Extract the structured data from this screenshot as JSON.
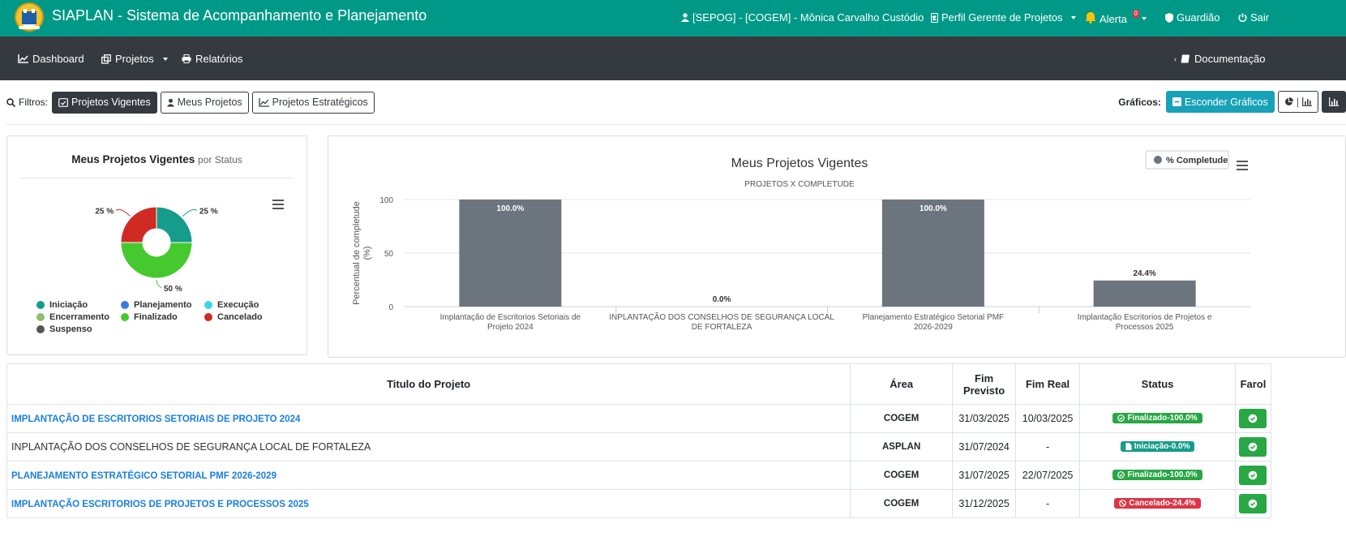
{
  "header": {
    "app_title": "SIAPLAN - Sistema de Acompanhamento e Planejamento",
    "user": "[SEPOG] - [COGEM] - Mônica Carvalho Custódio",
    "profile": "Perfil Gerente de Projetos",
    "alert_label": "Alerta",
    "alert_count": "0",
    "guardian": "Guardião",
    "logout": "Sair"
  },
  "navbar": {
    "dashboard": "Dashboard",
    "projects": "Projetos",
    "reports": "Relatórios",
    "documentation": "Documentação"
  },
  "filters": {
    "label": "Filtros:",
    "current": "Projetos Vigentes",
    "mine": "Meus Projetos",
    "strategic": "Projetos Estratégicos"
  },
  "charts_ctrl": {
    "label": "Gráficos:",
    "hide": "Esconder Gráficos"
  },
  "pie_card": {
    "title": "Meus Projetos Vigentes",
    "subtitle": "por Status"
  },
  "bar_card": {
    "title": "Meus Projetos Vigentes",
    "subtitle": "PROJETOS X COMPLETUDE",
    "legend": "% Completude",
    "ylabel": "Percentual de completude (%)"
  },
  "chart_data": [
    {
      "type": "pie",
      "title": "Meus Projetos Vigentes por Status",
      "labels": [
        "Iniciação",
        "Planejamento",
        "Execução",
        "Encerramento",
        "Finalizado",
        "Cancelado",
        "Suspenso"
      ],
      "values": [
        25,
        0,
        0,
        0,
        50,
        25,
        0
      ],
      "slice_labels": [
        "25 %",
        "50 %",
        "25 %"
      ],
      "colors": [
        "#169c8a",
        "#3b7ddd",
        "#3fd6ea",
        "#8fbf6f",
        "#45c92e",
        "#cf2b24",
        "#555555"
      ],
      "legend": "bottom"
    },
    {
      "type": "bar",
      "title": "Meus Projetos Vigentes",
      "subtitle": "PROJETOS X COMPLETUDE",
      "ylabel": "Percentual de completude (%)",
      "ylim": [
        0,
        100
      ],
      "yticks": [
        "0",
        "50",
        "100"
      ],
      "categories": [
        "Implantação de Escritorios Setoriais de Projeto 2024",
        "INPLANTAÇÃO DOS CONSELHOS DE SEGURANÇA LOCAL DE FORTALEZA",
        "Planejamento Estratégico Setorial PMF 2026-2029",
        "Implantação Escritorios de Projetos e Processos 2025"
      ],
      "series": [
        {
          "name": "% Completude",
          "values": [
            100,
            0,
            100,
            24.4
          ]
        }
      ],
      "data_labels": [
        "100.0%",
        "0.0%",
        "100.0%",
        "24.4%"
      ],
      "color": "#6c757d",
      "legend": "top-right"
    }
  ],
  "table": {
    "headers": [
      "Titulo do Projeto",
      "Área",
      "Fim Previsto",
      "Fim Real",
      "Status",
      "Farol"
    ],
    "rows": [
      {
        "title": "IMPLANTAÇÃO DE ESCRITORIOS SETORIAIS DE PROJETO 2024",
        "area": "COGEM",
        "fim_previsto": "31/03/2025",
        "fim_real": "10/03/2025",
        "status": "Finalizado-100.0%"
      },
      {
        "title": "INPLANTAÇÃO DOS CONSELHOS DE SEGURANÇA LOCAL DE FORTALEZA",
        "area": "ASPLAN",
        "fim_previsto": "31/07/2024",
        "fim_real": "-",
        "status": "Iniciação-0.0%"
      },
      {
        "title": "PLANEJAMENTO ESTRATÉGICO SETORIAL PMF 2026-2029",
        "area": "COGEM",
        "fim_previsto": "31/07/2025",
        "fim_real": "22/07/2025",
        "status": "Finalizado-100.0%"
      },
      {
        "title": "IMPLANTAÇÃO ESCRITORIOS DE PROJETOS E PROCESSOS 2025",
        "area": "COGEM",
        "fim_previsto": "31/12/2025",
        "fim_real": "-",
        "status": "Cancelado-24.4%"
      }
    ]
  },
  "colors": {
    "topbar": "#009987",
    "navbar": "#343a40",
    "link": "#1a7fe0",
    "success": "#28a745",
    "danger": "#dc3545",
    "info": "#17a2b8"
  }
}
